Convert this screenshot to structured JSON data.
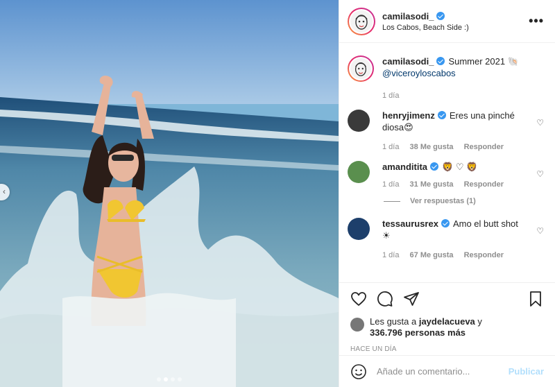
{
  "post": {
    "author": "camilasodi_",
    "location": "Los Cabos, Beach Side :)",
    "more_label": "•••"
  },
  "caption": {
    "user": "camilasodi_",
    "text": "Summer 2021 🐚",
    "mention": "@viceroyloscabos",
    "time": "1 día"
  },
  "comments": [
    {
      "user": "henryjimenz",
      "verified": true,
      "text": "Eres una pinché diosa😍",
      "time": "1 día",
      "likes": "38 Me gusta",
      "reply": "Responder"
    },
    {
      "user": "amanditita",
      "verified": true,
      "text": "🦁 ♡ 🦁",
      "time": "1 día",
      "likes": "31 Me gusta",
      "reply": "Responder"
    },
    {
      "user": "tessaurusrex",
      "verified": true,
      "text": "Amo el butt shot ☀",
      "time": "1 día",
      "likes": "67 Me gusta",
      "reply": "Responder"
    }
  ],
  "view_replies": "Ver respuestas (1)",
  "likes_summary": {
    "prefix": "Les gusta a",
    "user": "jaydelacueva",
    "suffix": "y",
    "count": "336.796 personas más"
  },
  "posted_ago": "HACE UN DÍA",
  "comment_box": {
    "placeholder": "Añade un comentario...",
    "publish": "Publicar"
  },
  "colors": {
    "verified": "#3897f0",
    "publish_disabled": "#b2dffc",
    "mention": "#00376b",
    "story_ring_start": "#f9a33b",
    "story_ring_end": "#c1349e"
  },
  "carousel": {
    "count": 4,
    "active": 1
  }
}
